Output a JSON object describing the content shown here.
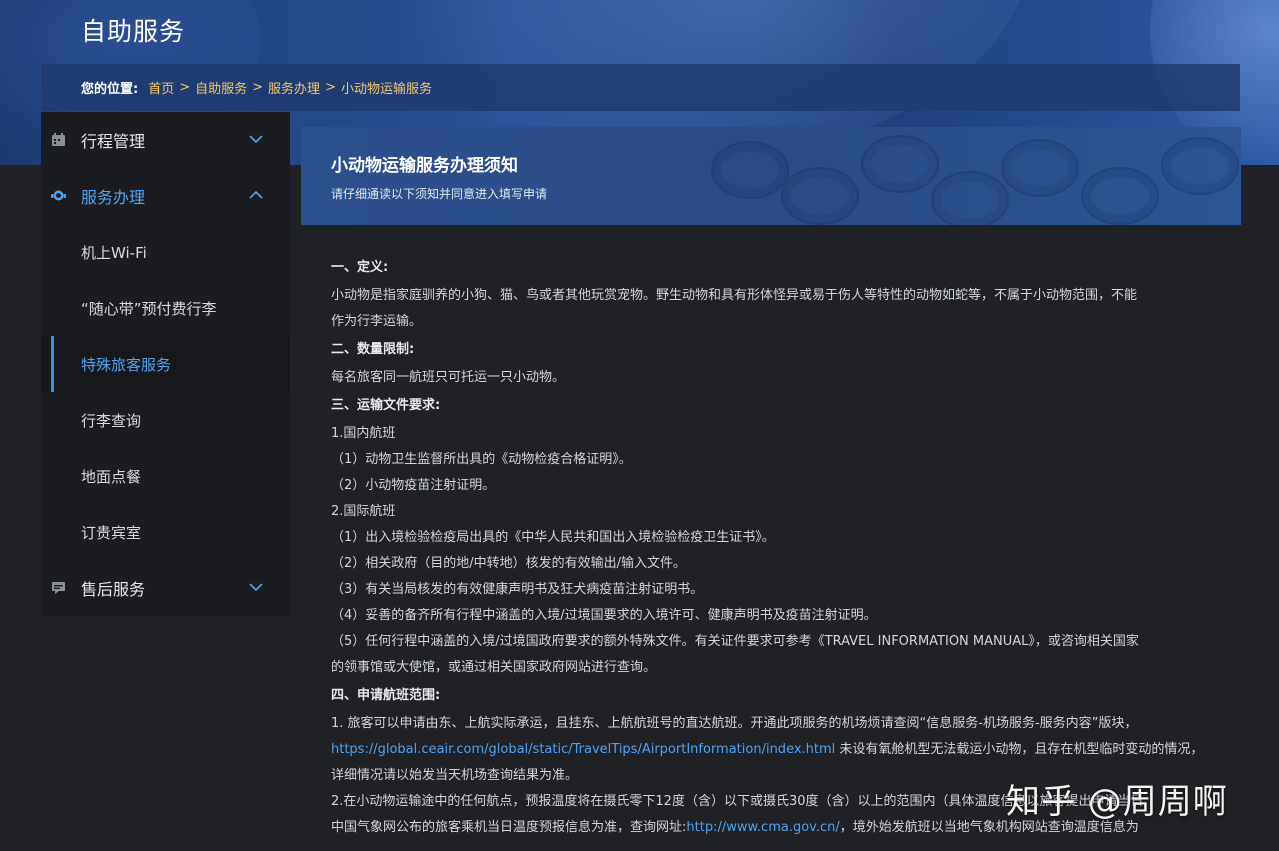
{
  "header": {
    "site_title": "自助服务"
  },
  "breadcrumb": {
    "label": "您的位置:",
    "items": [
      "首页",
      "自助服务",
      "服务办理",
      "小动物运输服务"
    ],
    "separator": ">"
  },
  "sidebar": {
    "group_trip": "行程管理",
    "group_service": "服务办理",
    "sub_items": [
      "机上Wi-Fi",
      "“随心带”预付费行李",
      "特殊旅客服务",
      "行李查询",
      "地面点餐",
      "订贵宾室"
    ],
    "group_after": "售后服务"
  },
  "content": {
    "title": "小动物运输服务办理须知",
    "subtitle": "请仔细通读以下须知并同意进入填写申请",
    "s1_title": "一、定义:",
    "s1_p1": "小动物是指家庭驯养的小狗、猫、鸟或者其他玩赏宠物。野生动物和具有形体怪异或易于伤人等特性的动物如蛇等，不属于小动物范围，不能",
    "s1_p2": "作为行李运输。",
    "s2_title": "二、数量限制:",
    "s2_p1": "每名旅客同一航班只可托运一只小动物。",
    "s3_title": "三、运输文件要求:",
    "s3_dom": "1.国内航班",
    "s3_dom_1": "（1）动物卫生监督所出具的《动物检疫合格证明》。",
    "s3_dom_2": "（2）小动物疫苗注射证明。",
    "s3_int": "2.国际航班",
    "s3_int_1": "（1）出入境检验检疫局出具的《中华人民共和国出入境检验检疫卫生证书》。",
    "s3_int_2": "（2）相关政府（目的地/中转地）核发的有效输出/输入文件。",
    "s3_int_3": "（3）有关当局核发的有效健康声明书及狂犬病疫苗注射证明书。",
    "s3_int_4": "（4）妥善的备齐所有行程中涵盖的入境/过境国要求的入境许可、健康声明书及疫苗注射证明。",
    "s3_int_5a": "（5）任何行程中涵盖的入境/过境国政府要求的额外特殊文件。有关证件要求可参考《TRAVEL INFORMATION MANUAL》，或咨询相关国家",
    "s3_int_5b": "的领事馆或大使馆，或通过相关国家政府网站进行查询。",
    "s4_title": "四、申请航班范围:",
    "s4_1a": "1. 旅客可以申请由东、上航实际承运，且挂东、上航航班号的直达航班。开通此项服务的机场烦请查阅“信息服务-机场服务-服务内容”版块，",
    "s4_1b_link": "https://global.ceair.com/global/static/TravelTips/AirportInformation/index.html",
    "s4_1b_rest": " 未设有氧舱机型无法载运小动物，且存在机型临时变动的情况，",
    "s4_1c": "详细情况请以始发当天机场查询结果为准。",
    "s4_2a": "2.在小动物运输途中的任何航点，预报温度将在摄氏零下12度（含）以下或摄氏30度（含）以上的范围内（具体温度信息以旅客提出申请当日",
    "s4_2b_pre": "中国气象网公布的旅客乘机当日温度预报信息为准，查询网址:",
    "s4_2b_link": "http://www.cma.gov.cn/",
    "s4_2b_rest": "，境外始发航班以当地气象机构网站查询温度信息为"
  },
  "watermark": "知乎 @周周啊",
  "colors": {
    "accent": "#4ea3f5",
    "crumb": "#f2c86a",
    "banner": "#2a5298"
  }
}
